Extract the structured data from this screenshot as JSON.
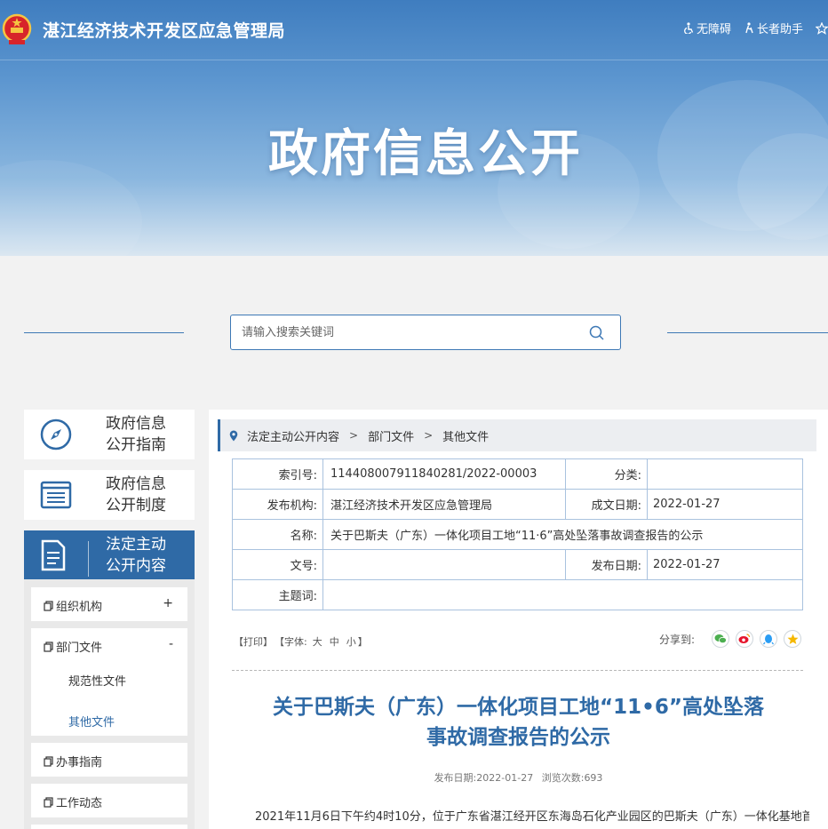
{
  "header": {
    "site_title": "湛江经济技术开发区应急管理局",
    "accessibility_label": "无障碍",
    "elderly_label": "长者助手",
    "banner_title": "政府信息公开"
  },
  "search": {
    "placeholder": "请输入搜索关键词"
  },
  "sidebar": {
    "cards": [
      {
        "line1": "政府信息",
        "line2": "公开指南"
      },
      {
        "line1": "政府信息",
        "line2": "公开制度"
      },
      {
        "line1": "法定主动",
        "line2": "公开内容"
      }
    ],
    "items": [
      {
        "label": "组织机构",
        "sign": "+"
      },
      {
        "label": "部门文件",
        "sign": "-",
        "children": [
          "规范性文件",
          "其他文件"
        ]
      },
      {
        "label": "办事指南"
      },
      {
        "label": "工作动态"
      }
    ]
  },
  "breadcrumb": [
    "法定主动公开内容",
    "部门文件",
    "其他文件"
  ],
  "meta": {
    "index_label": "索引号:",
    "index_value": "114408007911840281/2022-00003",
    "category_label": "分类:",
    "category_value": "",
    "publisher_label": "发布机构:",
    "publisher_value": "湛江经济技术开发区应急管理局",
    "created_label": "成文日期:",
    "created_value": "2022-01-27",
    "name_label": "名称:",
    "name_value": "关于巴斯夫（广东）一体化项目工地“11·6”高处坠落事故调查报告的公示",
    "docno_label": "文号:",
    "docno_value": "",
    "pubdate_label": "发布日期:",
    "pubdate_value": "2022-01-27",
    "keyword_label": "主题词:",
    "keyword_value": ""
  },
  "tools": {
    "print": "【打印】",
    "font_prefix": "【字体:",
    "font_large": "大",
    "font_medium": "中",
    "font_small": "小",
    "font_suffix": "】",
    "share_label": "分享到:"
  },
  "article": {
    "title_line1": "关于巴斯夫（广东）一体化项目工地“11•6”高处坠落",
    "title_line2": "事故调查报告的公示",
    "date_label": "发布日期:",
    "date_value": "2022-01-27",
    "views_label": "浏览次数:",
    "views_value": "693",
    "body_start": "2021年11月6日下午约4时10分，位于广东省湛江经开区东海岛石化产业园区的巴斯夫（广东）一体化基地首"
  },
  "colors": {
    "primary": "#2f6aa6",
    "banner": "#4a88c7",
    "border": "#a9c2de"
  }
}
